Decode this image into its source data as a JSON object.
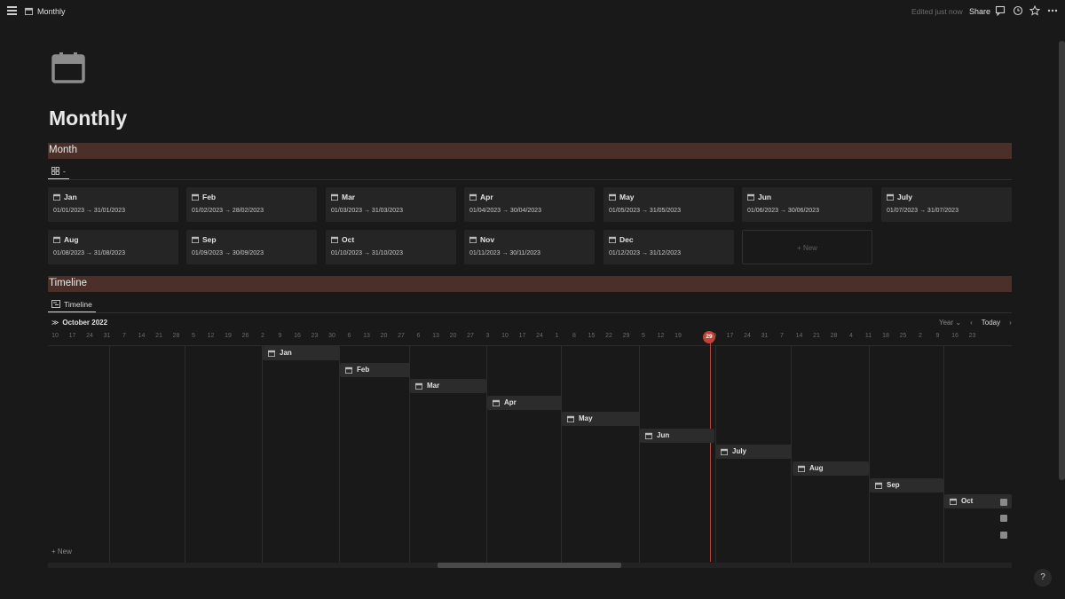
{
  "topbar": {
    "breadcrumb": "Monthly",
    "edited": "Edited just now",
    "share_label": "Share"
  },
  "page": {
    "title": "Monthly"
  },
  "month_section": {
    "title": "Month",
    "view_label": "-",
    "cards": [
      {
        "name": "Jan",
        "dates": "01/01/2023 → 31/01/2023"
      },
      {
        "name": "Feb",
        "dates": "01/02/2023 → 28/02/2023"
      },
      {
        "name": "Mar",
        "dates": "01/03/2023 → 31/03/2023"
      },
      {
        "name": "Apr",
        "dates": "01/04/2023 → 30/04/2023"
      },
      {
        "name": "May",
        "dates": "01/05/2023 → 31/05/2023"
      },
      {
        "name": "Jun",
        "dates": "01/06/2023 → 30/06/2023"
      },
      {
        "name": "July",
        "dates": "01/07/2023 → 31/07/2023"
      },
      {
        "name": "Aug",
        "dates": "01/08/2023 → 31/08/2023"
      },
      {
        "name": "Sep",
        "dates": "01/09/2023 → 30/09/2023"
      },
      {
        "name": "Oct",
        "dates": "01/10/2023 → 31/10/2023"
      },
      {
        "name": "Nov",
        "dates": "01/11/2023 → 30/11/2023"
      },
      {
        "name": "Dec",
        "dates": "01/12/2023 → 31/12/2023"
      }
    ],
    "new_label": "+ New"
  },
  "timeline_section": {
    "title": "Timeline",
    "view_label": "Timeline",
    "expand_glyph": "≫",
    "month_label": "October 2022",
    "scale_label": "Year ⌄",
    "today_label": "Today",
    "prev_glyph": "‹",
    "next_glyph": "›",
    "today_marker": "29",
    "day_ticks": [
      "10",
      "17",
      "24",
      "31",
      "7",
      "14",
      "21",
      "28",
      "5",
      "12",
      "19",
      "26",
      "2",
      "9",
      "16",
      "23",
      "30",
      "6",
      "13",
      "20",
      "27",
      "6",
      "13",
      "20",
      "27",
      "3",
      "10",
      "17",
      "24",
      "1",
      "8",
      "15",
      "22",
      "29",
      "5",
      "12",
      "19",
      "",
      "10",
      "17",
      "24",
      "31",
      "7",
      "14",
      "21",
      "28",
      "4",
      "11",
      "18",
      "25",
      "2",
      "9",
      "16",
      "23"
    ],
    "bars": [
      "Jan",
      "Feb",
      "Mar",
      "Apr",
      "May",
      "Jun",
      "July",
      "Aug",
      "Sep",
      "Oct"
    ],
    "new_label": "+ New"
  },
  "colors": {
    "background": "#191919",
    "section_bar": "#4a3029",
    "card": "#252525",
    "today_marker": "#c0433a"
  },
  "help_label": "?"
}
